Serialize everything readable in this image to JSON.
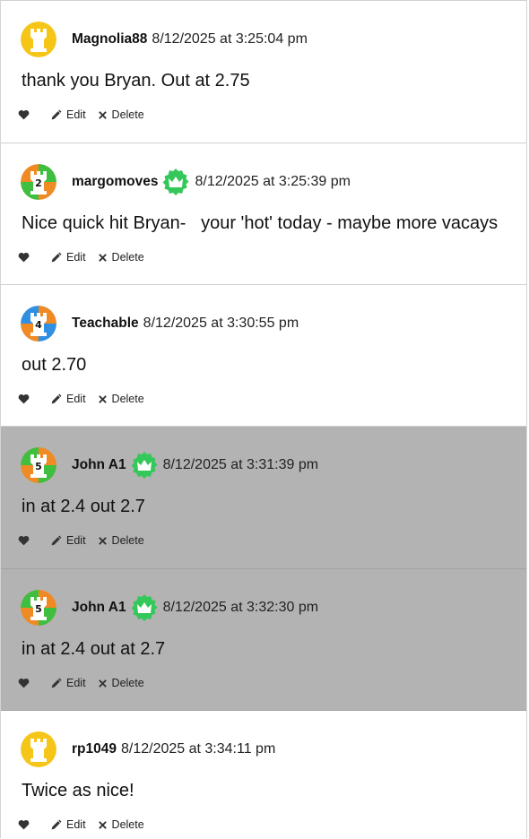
{
  "actions": {
    "edit_label": "Edit",
    "delete_label": "Delete"
  },
  "posts": [
    {
      "username": "Magnolia88",
      "timestamp": "8/12/2025 at 3:25:04 pm",
      "body": "thank you Bryan. Out at 2.75",
      "avatar": "rook-yellow",
      "highlighted": false
    },
    {
      "username": "margomoves",
      "timestamp": "8/12/2025 at 3:25:39 pm",
      "body": "Nice quick hit Bryan-   your 'hot' today - maybe more vacays",
      "avatar": "rook-orange-green-2",
      "badge": "crown-badge-icon",
      "highlighted": false
    },
    {
      "username": "Teachable",
      "timestamp": "8/12/2025 at 3:30:55 pm",
      "body": "out 2.70",
      "avatar": "rook-blue-orange-4",
      "highlighted": false
    },
    {
      "username": "John A1",
      "timestamp": "8/12/2025 at 3:31:39 pm",
      "body": "in at 2.4 out 2.7",
      "avatar": "rook-green-orange-5",
      "badge": "crown-badge-icon",
      "highlighted": true
    },
    {
      "username": "John A1",
      "timestamp": "8/12/2025 at 3:32:30 pm",
      "body": "in at 2.4 out at 2.7",
      "avatar": "rook-green-orange-5",
      "badge": "crown-badge-icon",
      "highlighted": true
    },
    {
      "username": "rp1049",
      "timestamp": "8/12/2025 at 3:34:11 pm",
      "body": "Twice as nice!",
      "avatar": "rook-yellow",
      "highlighted": false
    }
  ],
  "colors": {
    "highlight_bg": "#b3b3b3",
    "badge_green": "#34c759",
    "avatar_yellow": "#f5c518"
  }
}
